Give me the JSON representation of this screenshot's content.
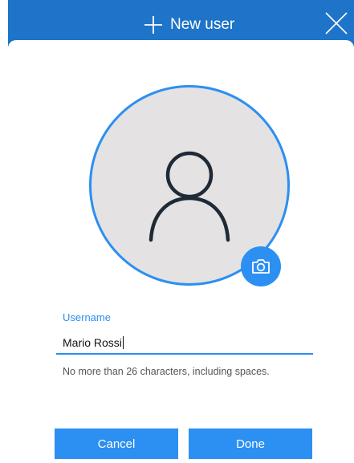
{
  "dialog": {
    "title": "New user",
    "title_icon": "plus-icon",
    "close_icon": "close-icon"
  },
  "avatar": {
    "icon": "person-icon",
    "camera_icon": "camera-icon"
  },
  "username_field": {
    "label": "Username",
    "value": "Mario Rossi",
    "hint": "No more than 26 characters, including spaces."
  },
  "buttons": {
    "cancel_label": "Cancel",
    "done_label": "Done"
  },
  "colors": {
    "title_bar": "#1e74c8",
    "accent": "#2c8ff2",
    "avatar_fill": "#e4e2e2",
    "icon_stroke": "#1f2a36"
  }
}
